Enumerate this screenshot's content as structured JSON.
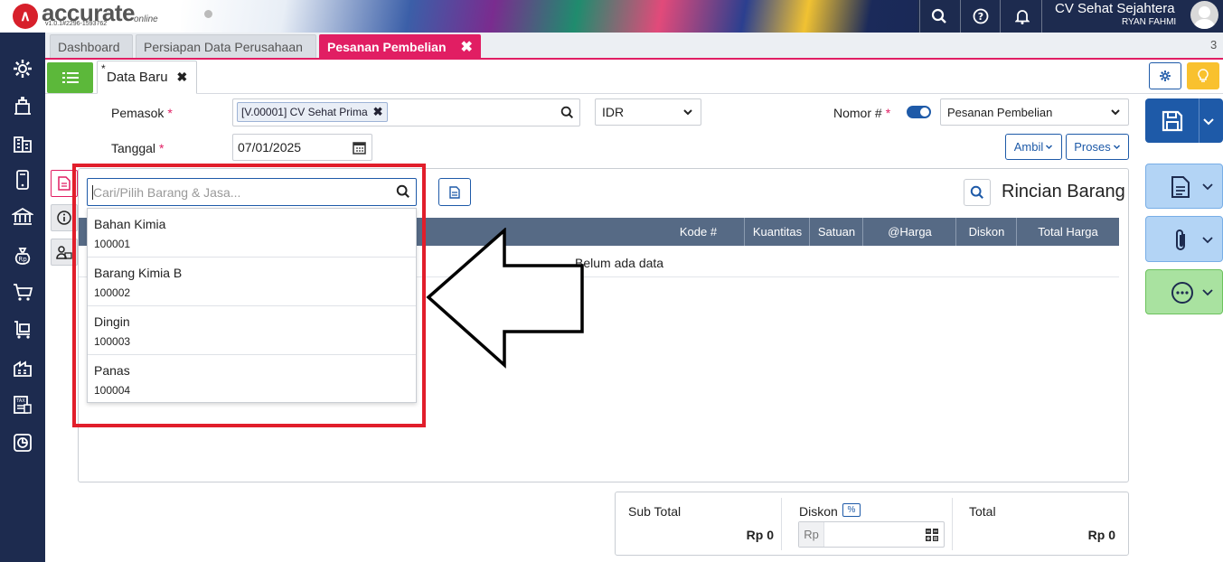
{
  "app": {
    "brand": "accurate",
    "brand_suffix": "online",
    "version": "v1.0.1#2296-1593762",
    "company": "CV Sehat Sejahtera",
    "user": "RYAN FAHMI"
  },
  "tabs": [
    {
      "label": "Dashboard"
    },
    {
      "label": "Persiapan Data Perusahaan"
    },
    {
      "label": "Pesanan Pembelian",
      "close": "✖"
    }
  ],
  "tab_count": "3",
  "subtab": {
    "star": "*",
    "label": "Data Baru",
    "close": "✖"
  },
  "form": {
    "pemasok_label": "Pemasok",
    "required_mark": "*",
    "pemasok_value": "[V.00001] CV Sehat Prima",
    "chip_close": "✖",
    "currency": "IDR",
    "nomor_label": "Nomor #",
    "nomor_type": "Pesanan Pembelian",
    "tanggal_label": "Tanggal",
    "tanggal_value": "07/01/2025",
    "ambil_label": "Ambil",
    "proses_label": "Proses"
  },
  "dropdown": {
    "placeholder": "Cari/Pilih Barang & Jasa...",
    "items": [
      {
        "name": "Bahan Kimia",
        "code": "100001"
      },
      {
        "name": "Barang Kimia B",
        "code": "100002"
      },
      {
        "name": "Dingin",
        "code": "100003"
      },
      {
        "name": "Panas",
        "code": "100004"
      }
    ]
  },
  "grid": {
    "title": "Rincian Barang",
    "columns": [
      "Kode #",
      "Kuantitas",
      "Satuan",
      "@Harga",
      "Diskon",
      "Total Harga"
    ],
    "empty_text": "Belum ada data"
  },
  "totals": {
    "subtotal_label": "Sub Total",
    "subtotal_value": "Rp 0",
    "diskon_label": "Diskon",
    "diskon_pct": "%",
    "diskon_prefix": "Rp",
    "total_label": "Total",
    "total_value": "Rp 0"
  },
  "colors": {
    "accent": "#e11e63",
    "sidebar": "#1d2b4f",
    "primary": "#1e5aa8",
    "highlight": "#e11e2b"
  }
}
